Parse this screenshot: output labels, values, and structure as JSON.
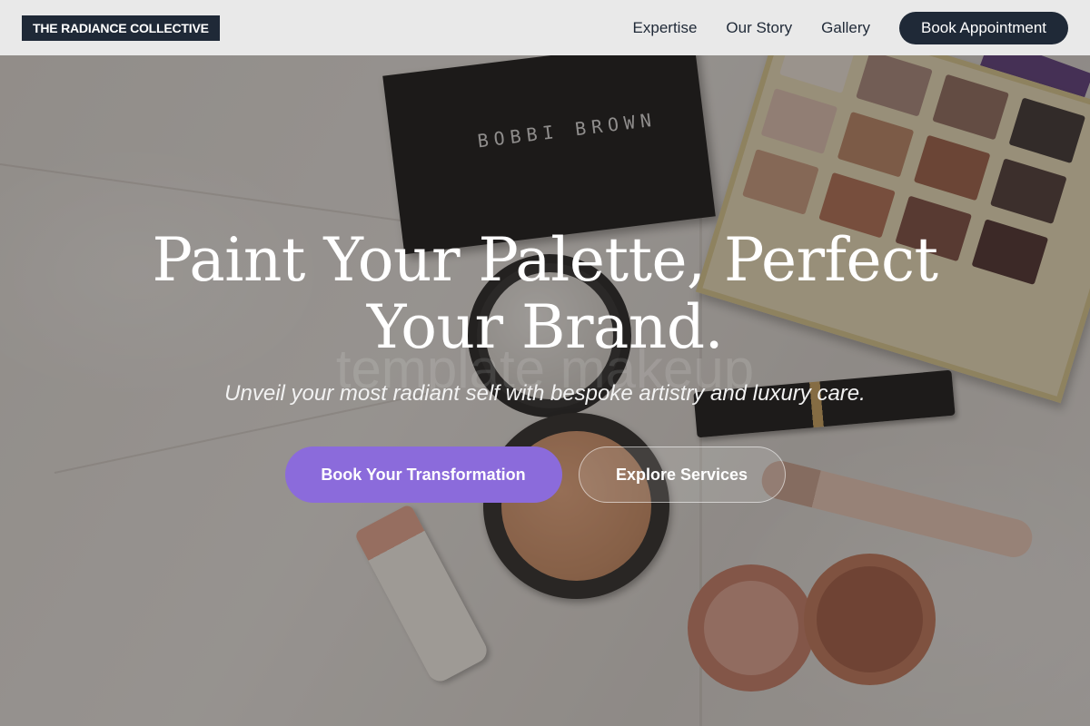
{
  "header": {
    "logo": "THE RADIANCE COLLECTIVE",
    "nav": [
      {
        "label": "Expertise"
      },
      {
        "label": "Our Story"
      },
      {
        "label": "Gallery"
      }
    ],
    "cta_label": "Book Appointment"
  },
  "hero": {
    "headline": "Paint Your Palette, Perfect Your Brand.",
    "watermark": "template makeup",
    "subtitle": "Unveil your most radiant self with bespoke artistry and luxury care.",
    "primary_button": "Book Your Transformation",
    "secondary_button": "Explore Services",
    "background_image": {
      "product_text": "BOBBI BROWN"
    }
  },
  "colors": {
    "header_bg": "#e9e9e9",
    "dark": "#1f2937",
    "accent": "#8b6bdb"
  }
}
